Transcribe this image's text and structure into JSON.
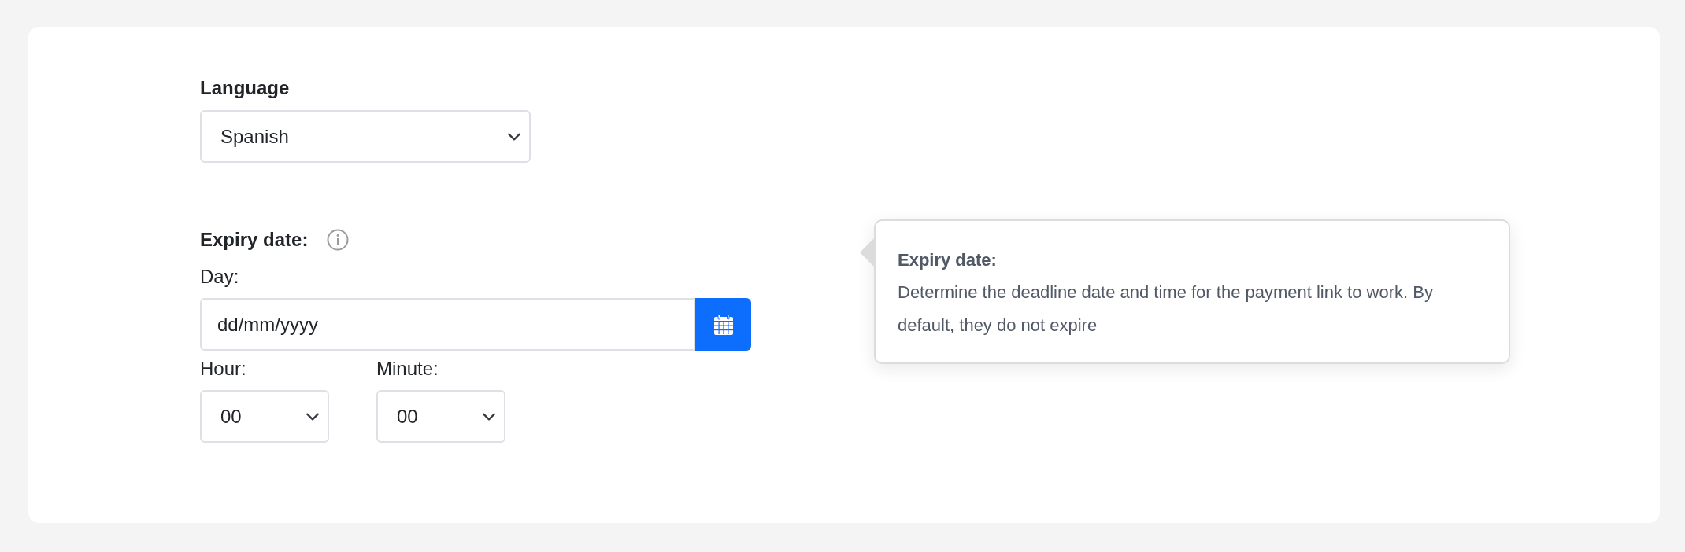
{
  "language": {
    "label": "Language",
    "value": "Spanish"
  },
  "expiry": {
    "label": "Expiry date:",
    "day_label": "Day:",
    "day_placeholder": "dd/mm/yyyy",
    "hour": {
      "label": "Hour:",
      "value": "00"
    },
    "minute": {
      "label": "Minute:",
      "value": "00"
    }
  },
  "tooltip": {
    "title": "Expiry date:",
    "text": "Determine the deadline date and time for the payment link to work. By default, they do not expire"
  }
}
